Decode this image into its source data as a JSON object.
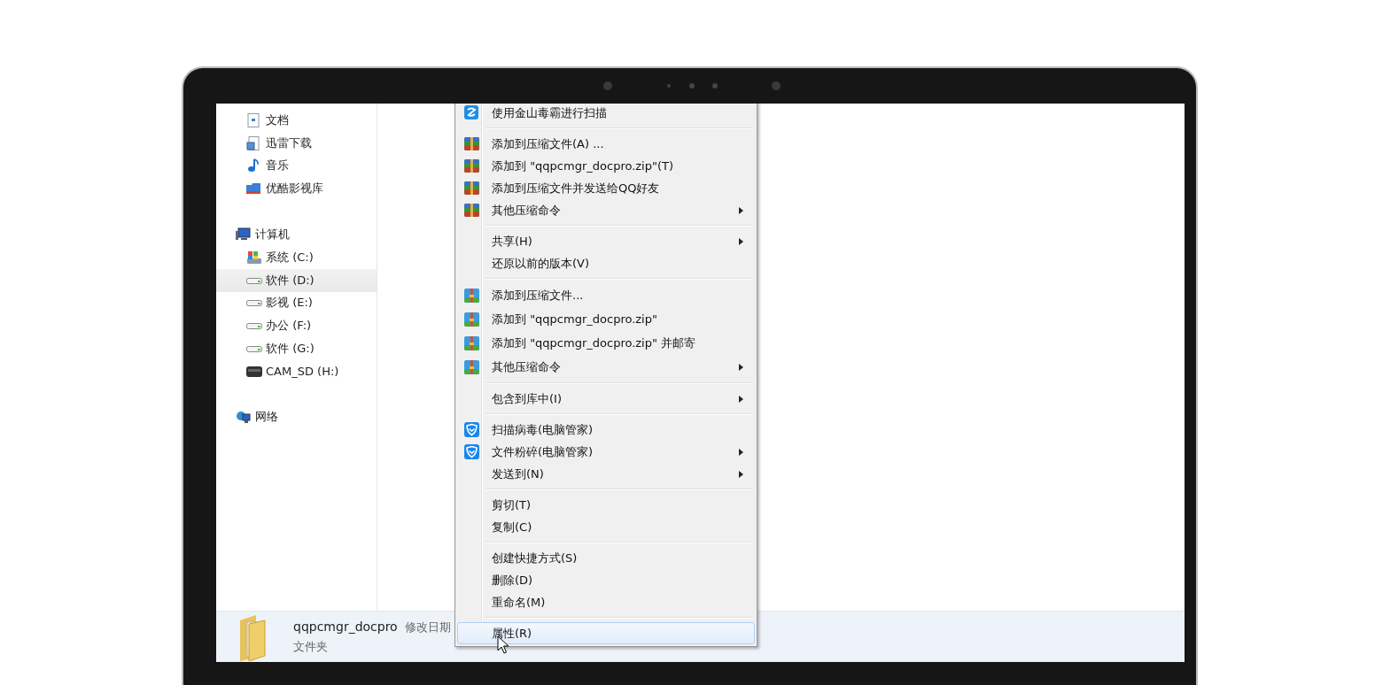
{
  "nav_sections": [
    {
      "items": [
        {
          "label": "文档",
          "kind": "document",
          "selected": false
        },
        {
          "label": "迅雷下载",
          "kind": "download",
          "selected": false
        },
        {
          "label": "音乐",
          "kind": "music",
          "selected": false
        },
        {
          "label": "优酷影视库",
          "kind": "video-library",
          "selected": false
        }
      ]
    },
    {
      "label": "计算机",
      "kind": "computer",
      "children": [
        {
          "label": "系统 (C:)",
          "kind": "system-drive",
          "selected": false
        },
        {
          "label": "软件 (D:)",
          "kind": "drive",
          "selected": true
        },
        {
          "label": "影视 (E:)",
          "kind": "drive",
          "selected": false
        },
        {
          "label": "办公 (F:)",
          "kind": "drive",
          "selected": false
        },
        {
          "label": "软件 (G:)",
          "kind": "drive",
          "selected": false
        },
        {
          "label": "CAM_SD (H:)",
          "kind": "removable",
          "selected": false
        }
      ]
    },
    {
      "label": "网络",
      "kind": "network"
    }
  ],
  "context_menu": {
    "groups": [
      [
        {
          "label": "使用金山毒霸进行扫描",
          "kind": "duba",
          "submenu": false,
          "selected": false
        }
      ],
      [
        {
          "label": "添加到压缩文件(A) ...",
          "kind": "zip-green",
          "submenu": false,
          "selected": false
        },
        {
          "label": "添加到 \"qqpcmgr_docpro.zip\"(T)",
          "kind": "zip-green",
          "submenu": false,
          "selected": false
        },
        {
          "label": "添加到压缩文件并发送给QQ好友",
          "kind": "zip-green",
          "submenu": false,
          "selected": false
        },
        {
          "label": "其他压缩命令",
          "kind": "zip-green",
          "submenu": true,
          "selected": false
        }
      ],
      [
        {
          "label": "共享(H)",
          "kind": "plain",
          "submenu": true,
          "selected": false
        },
        {
          "label": "还原以前的版本(V)",
          "kind": "plain",
          "submenu": false,
          "selected": false
        }
      ],
      [
        {
          "label": "添加到压缩文件...",
          "kind": "zip-blue",
          "submenu": false,
          "selected": false
        },
        {
          "label": "添加到 \"qqpcmgr_docpro.zip\"",
          "kind": "zip-blue",
          "submenu": false,
          "selected": false
        },
        {
          "label": "添加到 \"qqpcmgr_docpro.zip\" 并邮寄",
          "kind": "zip-blue",
          "submenu": false,
          "selected": false
        },
        {
          "label": "其他压缩命令",
          "kind": "zip-blue",
          "submenu": true,
          "selected": false
        }
      ],
      [
        {
          "label": "包含到库中(I)",
          "kind": "plain",
          "submenu": true,
          "selected": false
        }
      ],
      [
        {
          "label": "扫描病毒(电脑管家)",
          "kind": "shield",
          "submenu": false,
          "selected": false
        },
        {
          "label": "文件粉碎(电脑管家)",
          "kind": "shield",
          "submenu": true,
          "selected": false
        },
        {
          "label": "发送到(N)",
          "kind": "plain",
          "submenu": true,
          "selected": false
        }
      ],
      [
        {
          "label": "剪切(T)",
          "kind": "plain",
          "submenu": false,
          "selected": false
        },
        {
          "label": "复制(C)",
          "kind": "plain",
          "submenu": false,
          "selected": false
        }
      ],
      [
        {
          "label": "创建快捷方式(S)",
          "kind": "plain",
          "submenu": false,
          "selected": false
        },
        {
          "label": "删除(D)",
          "kind": "plain",
          "submenu": false,
          "selected": false
        },
        {
          "label": "重命名(M)",
          "kind": "plain",
          "submenu": false,
          "selected": false
        }
      ],
      [
        {
          "label": "属性(R)",
          "kind": "plain",
          "submenu": false,
          "selected": true
        }
      ]
    ]
  },
  "details_pane": {
    "name": "qqpcmgr_docpro",
    "date_label": "修改日期",
    "type": "文件夹"
  }
}
